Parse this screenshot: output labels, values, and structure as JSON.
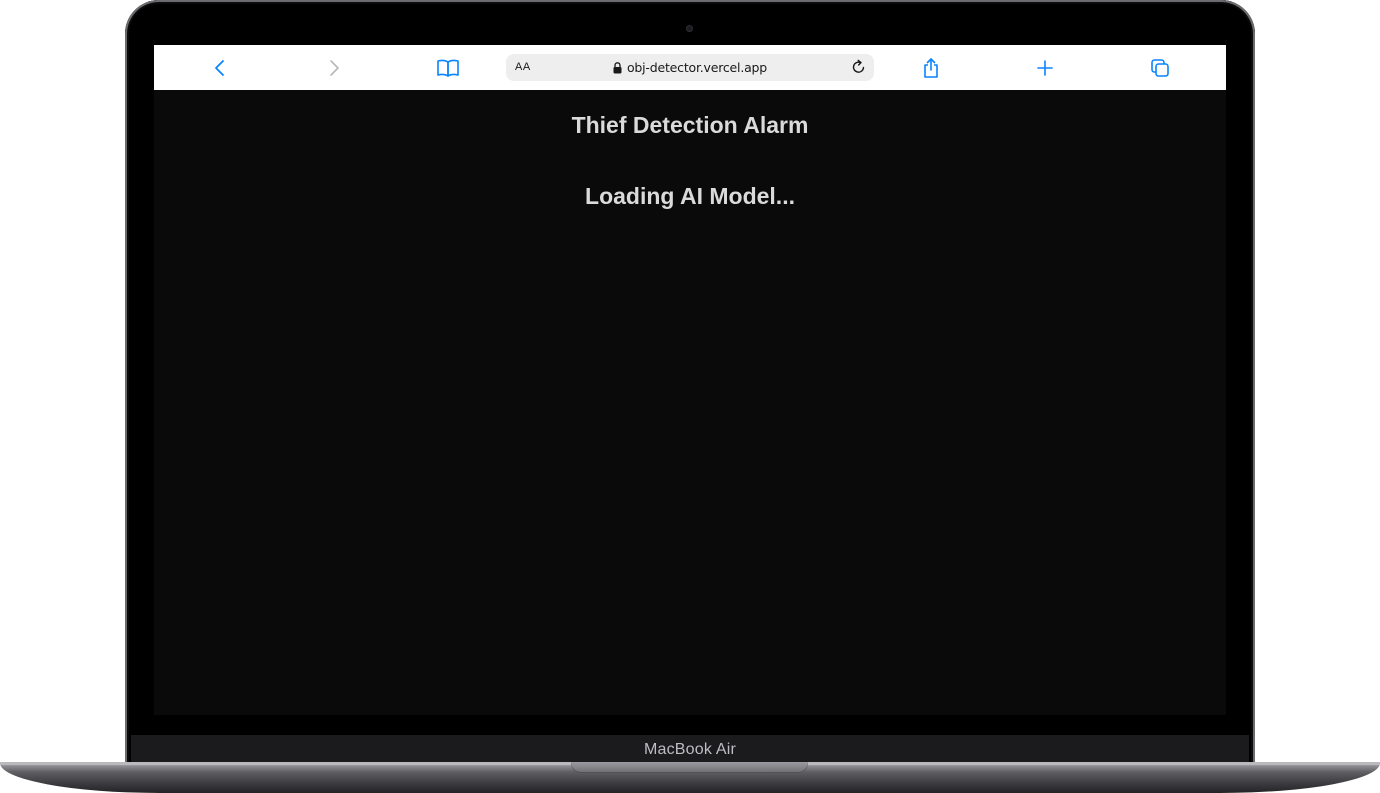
{
  "browser": {
    "url": "obj-detector.vercel.app",
    "text_size_label": "AA"
  },
  "page": {
    "title": "Thief Detection Alarm",
    "status": "Loading AI Model..."
  },
  "device": {
    "brand_label": "MacBook Air"
  },
  "icons": {
    "back": "chevron-left-icon",
    "forward": "chevron-right-icon",
    "bookmarks": "book-icon",
    "lock": "lock-icon",
    "reload": "reload-icon",
    "share": "share-icon",
    "new_tab": "plus-icon",
    "tabs": "tabs-icon"
  },
  "colors": {
    "accent": "#0a84ff",
    "page_background": "#0a0a0a",
    "page_text": "#dadada"
  }
}
